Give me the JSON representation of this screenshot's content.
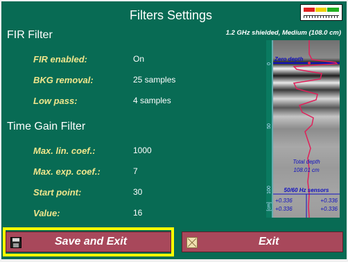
{
  "header": {
    "title": "Filters Settings",
    "subtitle": "1.2 GHz shielded, Medium (108.0 cm)"
  },
  "fir": {
    "title": "FIR Filter",
    "rows": [
      {
        "label": "FIR enabled:",
        "value": "On"
      },
      {
        "label": "BKG removal:",
        "value": "25 samples"
      },
      {
        "label": "Low pass:",
        "value": "4 samples"
      }
    ]
  },
  "tgf": {
    "title": "Time Gain Filter",
    "rows": [
      {
        "label": "Max. lin. coef.:",
        "value": "1000"
      },
      {
        "label": "Max. exp. coef.:",
        "value": "7"
      },
      {
        "label": "Start point:",
        "value": "30"
      },
      {
        "label": "Value:",
        "value": "16"
      }
    ]
  },
  "scan": {
    "zero_label": "Zero depth",
    "total_depth_label": "Total depth",
    "total_depth_value": "108.01 cm",
    "sensors_label": "50/60 Hz sensors",
    "sensor_values": [
      "+0.336",
      "+0.336",
      "+0.336",
      "+0.336"
    ],
    "axis_ticks": [
      "0",
      "50",
      "100"
    ],
    "axis_unit": "[cm]"
  },
  "buttons": {
    "save": "Save and Exit",
    "exit": "Exit"
  },
  "icons": {
    "save": "floppy-disk-icon",
    "exit": "cross-box-icon",
    "battery": "battery-level-icon"
  },
  "colors": {
    "background": "#086b54",
    "label": "#f0e68c",
    "button": "#a8485b",
    "highlight": "#ffff00",
    "trace": "#e0205a",
    "scan_text": "#1010c0"
  }
}
